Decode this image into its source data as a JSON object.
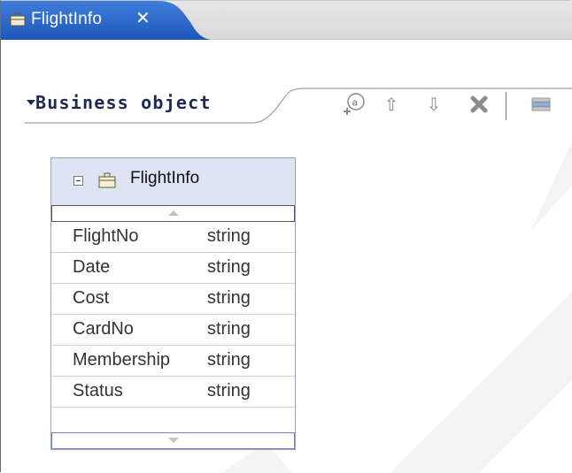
{
  "tab": {
    "label": "FlightInfo",
    "close": "✕"
  },
  "section": {
    "title": "Business object"
  },
  "toolbar": {
    "add_attr": "add-attribute-icon",
    "move_up": "⇧",
    "move_down": "⇩",
    "delete": "✖",
    "layout": "layout-icon"
  },
  "business_object": {
    "name": "FlightInfo",
    "fields": [
      {
        "name": "FlightNo",
        "type": "string"
      },
      {
        "name": "Date",
        "type": "string"
      },
      {
        "name": "Cost",
        "type": "string"
      },
      {
        "name": "CardNo",
        "type": "string"
      },
      {
        "name": "Membership",
        "type": "string"
      },
      {
        "name": "Status",
        "type": "string"
      },
      {
        "name": "",
        "type": ""
      }
    ]
  },
  "colors": {
    "tab_active": "#1f5fc7",
    "header_bg": "#dfe4f5",
    "title_text": "#1e2a52"
  }
}
